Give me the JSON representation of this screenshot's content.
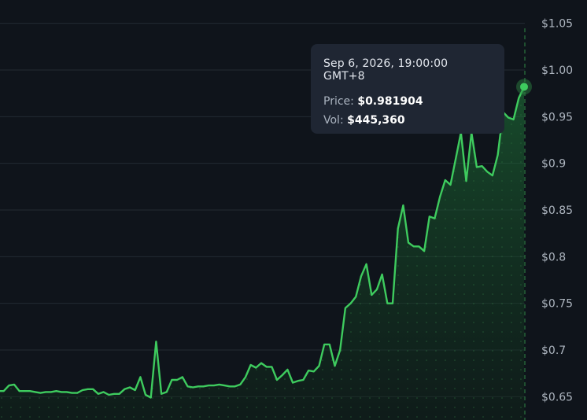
{
  "chart_data": {
    "type": "area",
    "y_ticks": [
      "$0.65",
      "$0.7",
      "$0.75",
      "$0.8",
      "$0.85",
      "$0.9",
      "$0.95",
      "$1.00",
      "$1.05"
    ],
    "y_tick_values": [
      0.65,
      0.7,
      0.75,
      0.8,
      0.85,
      0.9,
      0.95,
      1.0,
      1.05
    ],
    "ylim": [
      0.625,
      1.075
    ],
    "grid": true,
    "axis_position": "right",
    "colors": {
      "line": "#3ecb5e",
      "fill": "#1b5a2c",
      "grid": "#232a33",
      "crosshair": "#2f8a45",
      "tooltip_bg": "#1f2633"
    },
    "series": [
      {
        "values": [
          0.656,
          0.656,
          0.662,
          0.663,
          0.656,
          0.656,
          0.656,
          0.655,
          0.654,
          0.655,
          0.655,
          0.656,
          0.655,
          0.655,
          0.654,
          0.654,
          0.657,
          0.658,
          0.658,
          0.653,
          0.655,
          0.652,
          0.653,
          0.653,
          0.658,
          0.66,
          0.657,
          0.671,
          0.652,
          0.649,
          0.709,
          0.653,
          0.655,
          0.668,
          0.668,
          0.671,
          0.661,
          0.66,
          0.661,
          0.661,
          0.662,
          0.662,
          0.663,
          0.662,
          0.661,
          0.661,
          0.663,
          0.671,
          0.684,
          0.681,
          0.686,
          0.682,
          0.682,
          0.668,
          0.673,
          0.679,
          0.665,
          0.667,
          0.668,
          0.678,
          0.677,
          0.683,
          0.706,
          0.706,
          0.683,
          0.7,
          0.745,
          0.75,
          0.757,
          0.779,
          0.792,
          0.759,
          0.765,
          0.781,
          0.75,
          0.75,
          0.83,
          0.855,
          0.815,
          0.811,
          0.811,
          0.806,
          0.843,
          0.841,
          0.864,
          0.882,
          0.877,
          0.905,
          0.933,
          0.881,
          0.933,
          0.896,
          0.897,
          0.891,
          0.887,
          0.909,
          0.955,
          0.949,
          0.947,
          0.97,
          0.982
        ]
      }
    ]
  },
  "tooltip": {
    "date": "Sep 6, 2026, 19:00:00 GMT+8",
    "price_label": "Price:",
    "price_value": "$0.981904",
    "vol_label": "Vol:",
    "vol_value": "$445,360"
  }
}
